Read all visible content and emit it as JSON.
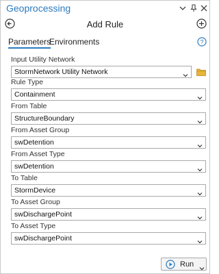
{
  "window": {
    "title": "Geoprocessing",
    "controls": {
      "menu_icon": "dropdown-menu-icon",
      "pin_icon": "pin-icon",
      "close_icon": "close-icon"
    }
  },
  "tool": {
    "title": "Add Rule",
    "back_icon": "back-arrow-icon",
    "add_icon": "add-plus-icon"
  },
  "tabs": [
    {
      "label": "Parameters",
      "active": true
    },
    {
      "label": "Environments",
      "active": false
    }
  ],
  "help_icon": "help-icon",
  "params": [
    {
      "label": "Input Utility Network",
      "value": "StormNetwork Utility Network",
      "browse_icon": "folder-icon"
    },
    {
      "label": "Rule Type",
      "value": "Containment"
    },
    {
      "label": "From Table",
      "value": "StructureBoundary"
    },
    {
      "label": "From Asset Group",
      "value": "swDetention"
    },
    {
      "label": "From Asset Type",
      "value": "swDetention"
    },
    {
      "label": "To Table",
      "value": "StormDevice"
    },
    {
      "label": "To Asset Group",
      "value": "swDischargePoint"
    },
    {
      "label": "To Asset Type",
      "value": "swDischargePoint"
    }
  ],
  "footer": {
    "run_label": "Run",
    "run_icon": "play-icon"
  },
  "colors": {
    "accent": "#2a7abf",
    "border": "#a8a8a8",
    "run_play": "#2a7abf",
    "folder": "#e8b53a"
  }
}
